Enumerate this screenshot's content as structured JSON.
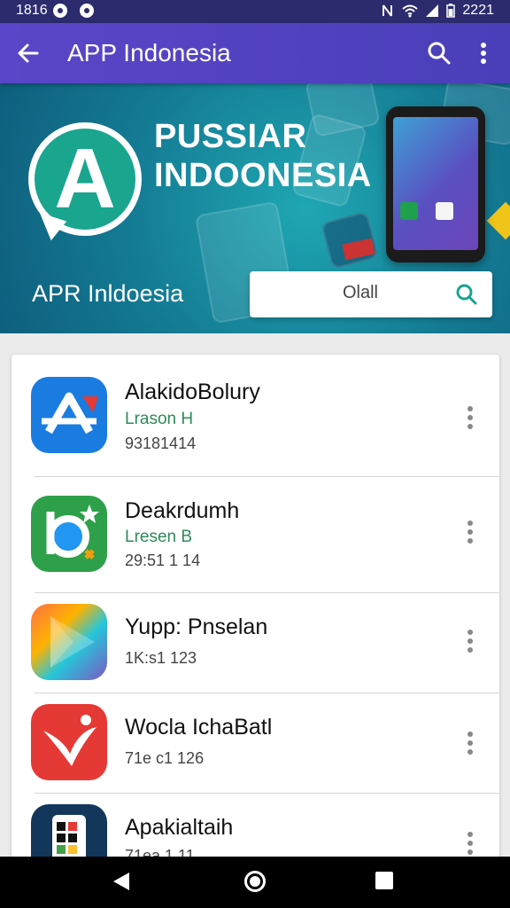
{
  "status_bar": {
    "time": "1816",
    "battery": "2221"
  },
  "app_bar": {
    "title": "APP Indonesia",
    "back_icon": "arrow-back-icon",
    "search_icon": "search-icon",
    "more_icon": "more-vert-icon"
  },
  "banner": {
    "title_line1": "PUSSIAR",
    "title_line2": "INDOONESIA",
    "subtitle": "APR Inldoesia",
    "logo_letter": "A",
    "search_value": "Olall"
  },
  "apps": [
    {
      "name": "AlakidoBolury",
      "sub": "Lrason H",
      "meta": "93181414"
    },
    {
      "name": "Deakrdumh",
      "sub": "Lresen B",
      "meta": "29:51 1 14"
    },
    {
      "name": "Yupp: Pnselan",
      "sub": "",
      "meta": "1K:s1 123"
    },
    {
      "name": "Wocla IchaBatl",
      "sub": "",
      "meta": "71e c1 126"
    },
    {
      "name": "Apakialtaih",
      "sub": "",
      "meta": "71ea 1 11"
    }
  ],
  "colors": {
    "status_bar": "#2b2b6e",
    "app_bar": "#5446c4",
    "banner": "#147a93",
    "accent_green": "#2e8b57"
  }
}
